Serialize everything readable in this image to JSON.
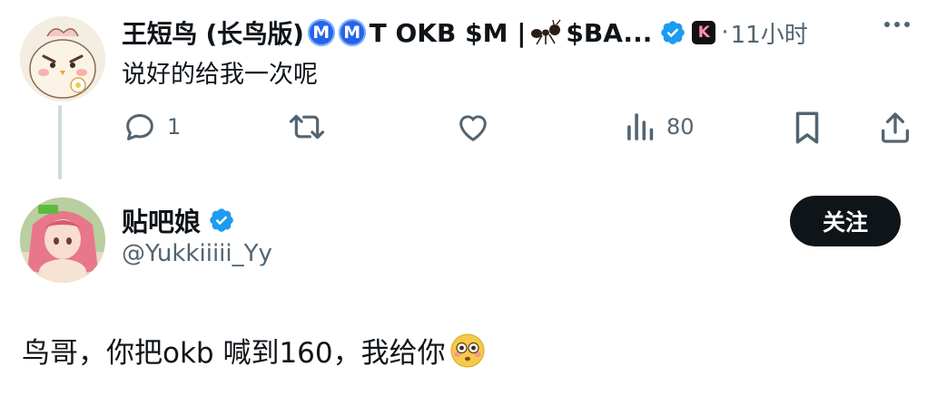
{
  "reply": {
    "name_part1": "王短鸟 (长鸟版)",
    "m_badge_1": "M",
    "m_badge_2": "M",
    "name_part2": "T OKB $M |",
    "name_part3": "$BA...",
    "k_badge": "K",
    "dot": "·",
    "time": "11小时",
    "text": "说好的给我一次呢",
    "reply_count": "1",
    "view_count": "80"
  },
  "quoted": {
    "name": "贴吧娘",
    "handle": "@Yukkiiiii_Yy",
    "follow_label": "关注",
    "text": "鸟哥，你把okb 喊到160，我给你"
  },
  "icons": {
    "verified": "verified-badge-icon",
    "ant": "ant-emoji-icon",
    "flushed": "flushed-face-emoji-icon"
  },
  "colors": {
    "verified_blue": "#1d9bf0",
    "m_badge": "#2563eb",
    "secondary_text": "#536471",
    "follow_bg": "#0f1419"
  }
}
